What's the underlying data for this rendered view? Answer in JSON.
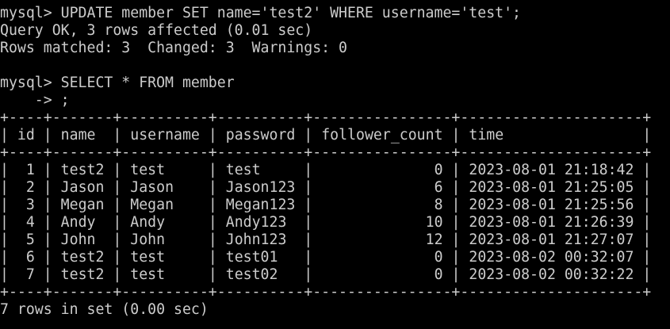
{
  "session": {
    "update_prompt": "mysql>",
    "update_command": "UPDATE member SET name='test2' WHERE username='test';",
    "update_result": "Query OK, 3 rows affected (0.01 sec)",
    "update_stats": "Rows matched: 3  Changed: 3  Warnings: 0",
    "select_prompt": "mysql>",
    "select_command": "SELECT * FROM member",
    "continuation_prompt": "    ->",
    "continuation_text": ";",
    "select_footer": "7 rows in set (0.00 sec)"
  },
  "table": {
    "border_top": "+----+-------+----------+----------+----------------+---------------------+",
    "border_mid": "+----+-------+----------+----------+----------------+---------------------+",
    "border_bottom": "+----+-------+----------+----------+----------------+---------------------+",
    "columns": [
      "id",
      "name",
      "username",
      "password",
      "follower_count",
      "time"
    ],
    "rows": [
      [
        "1",
        "test2",
        "test",
        "test",
        "0",
        "2023-08-01 21:18:42"
      ],
      [
        "2",
        "Jason",
        "Jason",
        "Jason123",
        "6",
        "2023-08-01 21:25:05"
      ],
      [
        "3",
        "Megan",
        "Megan",
        "Megan123",
        "8",
        "2023-08-01 21:25:56"
      ],
      [
        "4",
        "Andy",
        "Andy",
        "Andy123",
        "10",
        "2023-08-01 21:26:39"
      ],
      [
        "5",
        "John",
        "John",
        "John123",
        "12",
        "2023-08-01 21:27:07"
      ],
      [
        "6",
        "test2",
        "test",
        "test01",
        "0",
        "2023-08-02 00:32:07"
      ],
      [
        "7",
        "test2",
        "test",
        "test02",
        "0",
        "2023-08-02 00:32:22"
      ]
    ]
  }
}
